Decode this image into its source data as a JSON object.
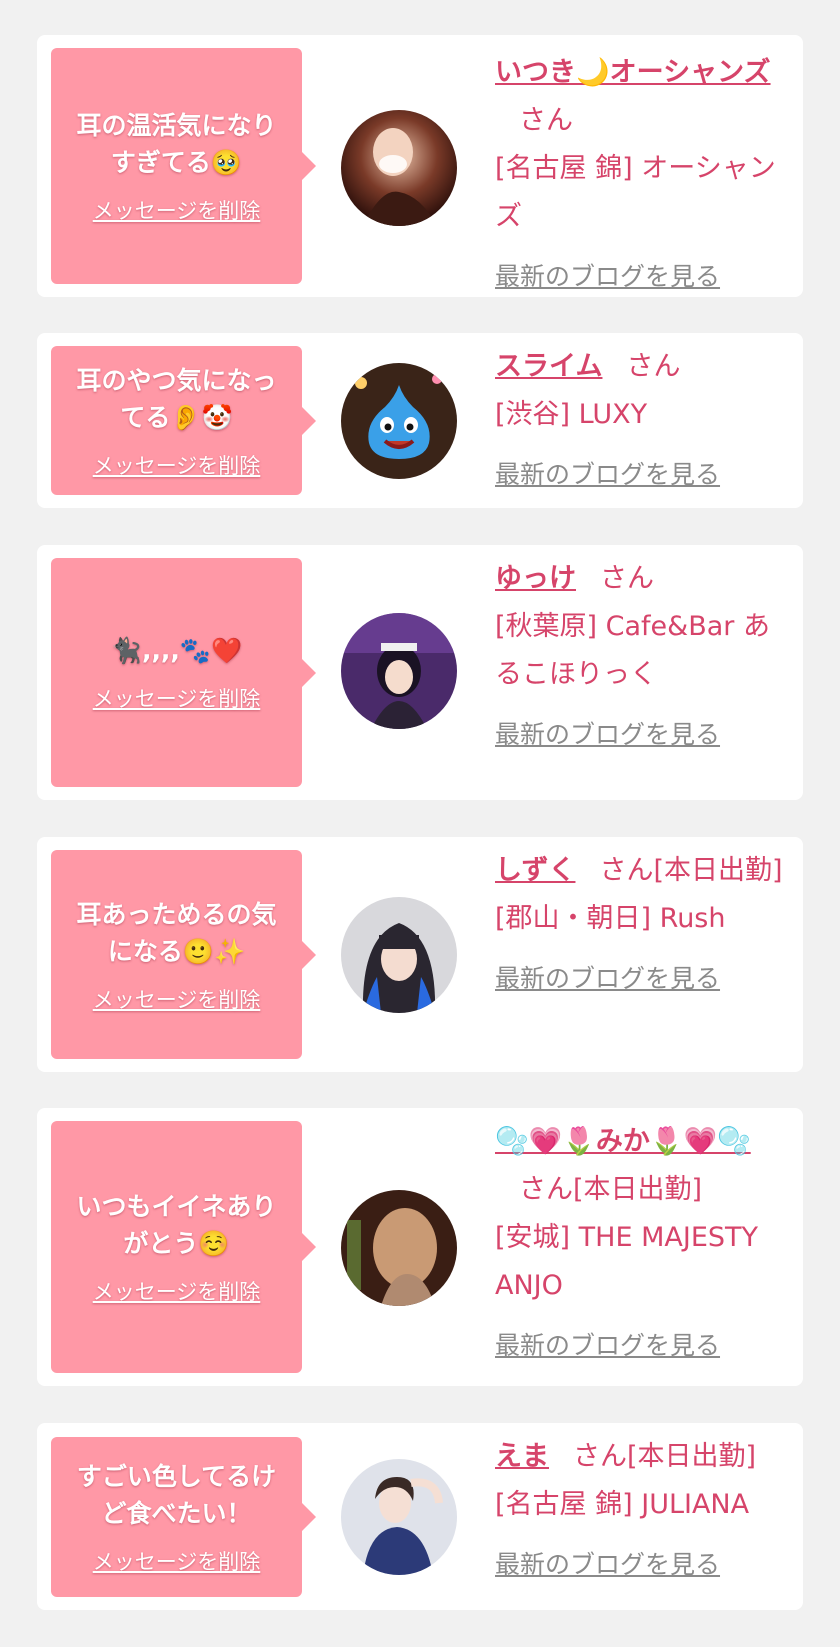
{
  "colors": {
    "page_bg": "#f1f1f1",
    "card_bg": "#ffffff",
    "bubble_bg": "#ff98a6",
    "accent": "#d6446a",
    "link_gray": "#8a8a8a"
  },
  "delete_label": "メッセージを削除",
  "blog_label": "最新のブログを見る",
  "items": [
    {
      "message": "耳の温活気になりすぎてる🥹",
      "name": "いつき🌙オーシャンズ",
      "honorific": "さん",
      "shop": "[名古屋 錦] オーシャンズ",
      "avatar_icon": "user-photo"
    },
    {
      "message": "耳のやつ気になってる👂🤡",
      "name": "スライム",
      "honorific": "さん",
      "shop": "[渋谷] LUXY",
      "avatar_icon": "slime-photo"
    },
    {
      "message": "🐈‍⬛,,,,🐾❤️",
      "name": "ゆっけ",
      "honorific": "さん",
      "shop": "[秋葉原] Cafe&Bar あるこほりっく",
      "avatar_icon": "user-photo"
    },
    {
      "message": "耳あっためるの気になる🙂✨",
      "name": "しずく",
      "honorific": "さん[本日出勤]",
      "shop": "[郡山・朝日] Rush",
      "avatar_icon": "user-photo"
    },
    {
      "message": "いつもイイネありがとう☺️",
      "name": "🫧💗🌷みか🌷💗🫧",
      "honorific": "さん[本日出勤]",
      "shop": "[安城] THE MAJESTY ANJO",
      "avatar_icon": "user-photo"
    },
    {
      "message": "すごい色してるけど食べたい！",
      "name": "えま",
      "honorific": "さん[本日出勤]",
      "shop": "[名古屋 錦] JULIANA",
      "avatar_icon": "user-photo"
    }
  ]
}
